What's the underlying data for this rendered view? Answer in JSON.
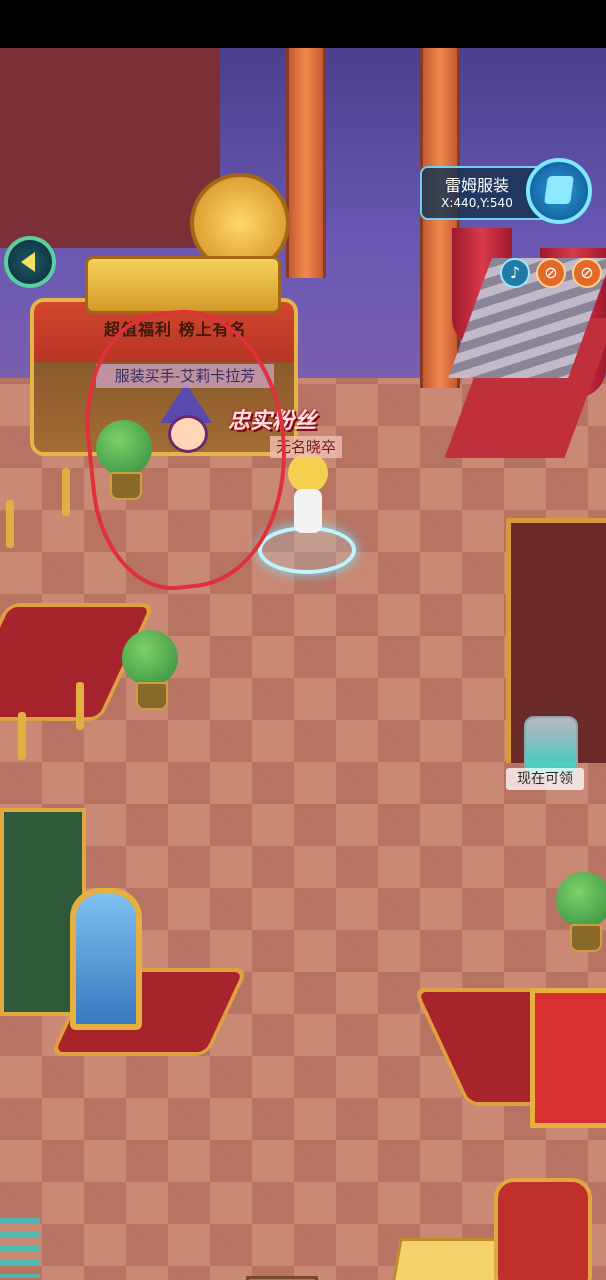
{
  "hud": {
    "location_name": "雷姆服装",
    "coordinates": "X:440,Y:540",
    "sound_icon": "speaker-icon",
    "mute_icon": "mute-icon",
    "block_icon": "block-icon"
  },
  "scene": {
    "shop_sign": "超值福利 榜上有名",
    "npc_title": "服装买手-艾莉卡拉芳",
    "fan_badge": "忠实粉丝",
    "player_name": "无名晓卒",
    "claim_label": "现在可领"
  },
  "colors": {
    "annotation_circle": "#e0303a",
    "hud_panel": "#143250",
    "hud_border": "#6fd0f0",
    "floor": "#c98974"
  }
}
